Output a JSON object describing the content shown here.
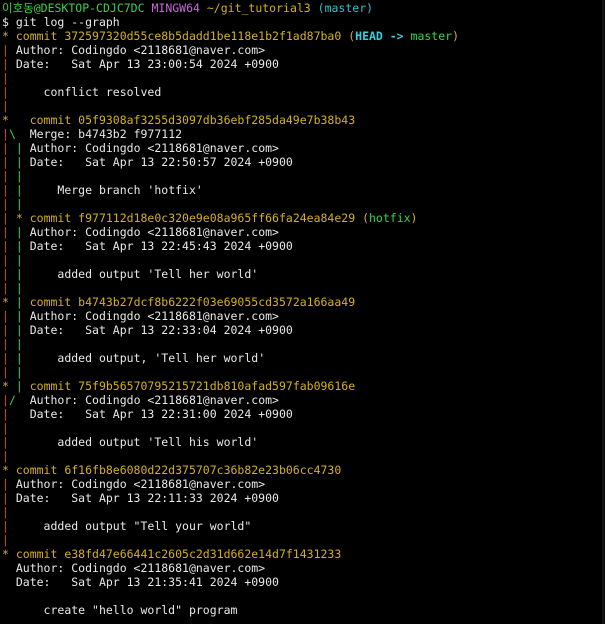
{
  "prompt": {
    "user_host": "이호동@DESKTOP-CDJC7DC",
    "shell": "MINGW64",
    "path": "~/git_tutorial3",
    "branch": "(master)",
    "symbol": "$",
    "command": "git log --graph"
  },
  "colors": {
    "graph_red": "#e03a3a",
    "graph_green": "#3bd14b",
    "commit_yellow": "#d5b01e",
    "prompt_magenta": "#c86ad6",
    "branch_cyan": "#2fbfcf",
    "text": "#e8e8e8",
    "background": "#000000"
  },
  "lines": [
    {
      "graph": "",
      "parts": [
        {
          "t": "prompt.user_host",
          "c": "c-green"
        },
        {
          "s": " "
        },
        {
          "t": "prompt.shell",
          "c": "c-magenta"
        },
        {
          "s": " "
        },
        {
          "t": "prompt.path",
          "c": "c-yellow"
        },
        {
          "s": " "
        },
        {
          "t": "prompt.branch",
          "c": "c-cyan"
        }
      ]
    },
    {
      "graph": "",
      "parts": [
        {
          "t": "prompt.symbol",
          "c": "c-white"
        },
        {
          "s": " "
        },
        {
          "t": "prompt.command",
          "c": "c-white"
        }
      ]
    },
    {
      "g": [
        {
          "s": "* ",
          "c": "c-yellow"
        }
      ],
      "parts": [
        {
          "text": "commit 372597320d55ce8b5dadd1be118e1b2f1ad87ba0",
          "c": "c-yellow"
        },
        {
          "text": " (",
          "c": "c-yellow"
        },
        {
          "text": "HEAD -> ",
          "c": "c-head"
        },
        {
          "text": "master",
          "c": "c-green"
        },
        {
          "text": ")",
          "c": "c-yellow"
        }
      ]
    },
    {
      "g": [
        {
          "s": "| ",
          "c": "c-red"
        }
      ],
      "parts": [
        {
          "text": "Author: Codingdo <2118681@naver.com>"
        }
      ]
    },
    {
      "g": [
        {
          "s": "| ",
          "c": "c-red"
        }
      ],
      "parts": [
        {
          "text": "Date:   Sat Apr 13 23:00:54 2024 +0900"
        }
      ]
    },
    {
      "g": [
        {
          "s": "| ",
          "c": "c-red"
        }
      ],
      "parts": []
    },
    {
      "g": [
        {
          "s": "| ",
          "c": "c-red"
        }
      ],
      "parts": [
        {
          "text": "    conflict resolved"
        }
      ]
    },
    {
      "g": [
        {
          "s": "| ",
          "c": "c-red"
        }
      ],
      "parts": []
    },
    {
      "g": [
        {
          "s": "*   ",
          "c": "c-yellow"
        }
      ],
      "parts": [
        {
          "text": "commit 05f9308af3255d3097db36ebf285da49e7b38b43",
          "c": "c-yellow"
        }
      ]
    },
    {
      "g": [
        {
          "s": "|",
          "c": "c-red"
        },
        {
          "s": "\\  ",
          "c": "c-green"
        }
      ],
      "parts": [
        {
          "text": "Merge: b4743b2 f977112"
        }
      ]
    },
    {
      "g": [
        {
          "s": "| ",
          "c": "c-red"
        },
        {
          "s": "| ",
          "c": "c-green"
        }
      ],
      "parts": [
        {
          "text": "Author: Codingdo <2118681@naver.com>"
        }
      ]
    },
    {
      "g": [
        {
          "s": "| ",
          "c": "c-red"
        },
        {
          "s": "| ",
          "c": "c-green"
        }
      ],
      "parts": [
        {
          "text": "Date:   Sat Apr 13 22:50:57 2024 +0900"
        }
      ]
    },
    {
      "g": [
        {
          "s": "| ",
          "c": "c-red"
        },
        {
          "s": "| ",
          "c": "c-green"
        }
      ],
      "parts": []
    },
    {
      "g": [
        {
          "s": "| ",
          "c": "c-red"
        },
        {
          "s": "| ",
          "c": "c-green"
        }
      ],
      "parts": [
        {
          "text": "    Merge branch 'hotfix'"
        }
      ]
    },
    {
      "g": [
        {
          "s": "| ",
          "c": "c-red"
        },
        {
          "s": "| ",
          "c": "c-green"
        }
      ],
      "parts": []
    },
    {
      "g": [
        {
          "s": "| ",
          "c": "c-red"
        },
        {
          "s": "* ",
          "c": "c-yellow"
        }
      ],
      "parts": [
        {
          "text": "commit f977112d18e0c320e9e08a965ff66fa24ea84e29",
          "c": "c-yellow"
        },
        {
          "text": " (",
          "c": "c-yellow"
        },
        {
          "text": "hotfix",
          "c": "c-green"
        },
        {
          "text": ")",
          "c": "c-yellow"
        }
      ]
    },
    {
      "g": [
        {
          "s": "| ",
          "c": "c-red"
        },
        {
          "s": "| ",
          "c": "c-green"
        }
      ],
      "parts": [
        {
          "text": "Author: Codingdo <2118681@naver.com>"
        }
      ]
    },
    {
      "g": [
        {
          "s": "| ",
          "c": "c-red"
        },
        {
          "s": "| ",
          "c": "c-green"
        }
      ],
      "parts": [
        {
          "text": "Date:   Sat Apr 13 22:45:43 2024 +0900"
        }
      ]
    },
    {
      "g": [
        {
          "s": "| ",
          "c": "c-red"
        },
        {
          "s": "| ",
          "c": "c-green"
        }
      ],
      "parts": []
    },
    {
      "g": [
        {
          "s": "| ",
          "c": "c-red"
        },
        {
          "s": "| ",
          "c": "c-green"
        }
      ],
      "parts": [
        {
          "text": "    added output 'Tell her world'"
        }
      ]
    },
    {
      "g": [
        {
          "s": "| ",
          "c": "c-red"
        },
        {
          "s": "| ",
          "c": "c-green"
        }
      ],
      "parts": []
    },
    {
      "g": [
        {
          "s": "* ",
          "c": "c-yellow"
        },
        {
          "s": "| ",
          "c": "c-green"
        }
      ],
      "parts": [
        {
          "text": "commit b4743b27dcf8b6222f03e69055cd3572a166aa49",
          "c": "c-yellow"
        }
      ]
    },
    {
      "g": [
        {
          "s": "| ",
          "c": "c-red"
        },
        {
          "s": "| ",
          "c": "c-green"
        }
      ],
      "parts": [
        {
          "text": "Author: Codingdo <2118681@naver.com>"
        }
      ]
    },
    {
      "g": [
        {
          "s": "| ",
          "c": "c-red"
        },
        {
          "s": "| ",
          "c": "c-green"
        }
      ],
      "parts": [
        {
          "text": "Date:   Sat Apr 13 22:33:04 2024 +0900"
        }
      ]
    },
    {
      "g": [
        {
          "s": "| ",
          "c": "c-red"
        },
        {
          "s": "| ",
          "c": "c-green"
        }
      ],
      "parts": []
    },
    {
      "g": [
        {
          "s": "| ",
          "c": "c-red"
        },
        {
          "s": "| ",
          "c": "c-green"
        }
      ],
      "parts": [
        {
          "text": "    added output, 'Tell her world'"
        }
      ]
    },
    {
      "g": [
        {
          "s": "| ",
          "c": "c-red"
        },
        {
          "s": "| ",
          "c": "c-green"
        }
      ],
      "parts": []
    },
    {
      "g": [
        {
          "s": "* ",
          "c": "c-yellow"
        },
        {
          "s": "| ",
          "c": "c-green"
        }
      ],
      "parts": [
        {
          "text": "commit 75f9b56570795215721db810afad597fab09616e",
          "c": "c-yellow"
        }
      ]
    },
    {
      "g": [
        {
          "s": "|",
          "c": "c-red"
        },
        {
          "s": "/  ",
          "c": "c-green"
        }
      ],
      "parts": [
        {
          "text": "Author: Codingdo <2118681@naver.com>"
        }
      ]
    },
    {
      "g": [
        {
          "s": "|   ",
          "c": "c-red"
        }
      ],
      "parts": [
        {
          "text": "Date:   Sat Apr 13 22:31:00 2024 +0900"
        }
      ]
    },
    {
      "g": [
        {
          "s": "|   ",
          "c": "c-red"
        }
      ],
      "parts": []
    },
    {
      "g": [
        {
          "s": "|   ",
          "c": "c-red"
        }
      ],
      "parts": [
        {
          "text": "    added output 'Tell his world'"
        }
      ]
    },
    {
      "g": [
        {
          "s": "|   ",
          "c": "c-red"
        }
      ],
      "parts": []
    },
    {
      "g": [
        {
          "s": "* ",
          "c": "c-yellow"
        }
      ],
      "parts": [
        {
          "text": "commit 6f16fb8e6080d22d375707c36b82e23b06cc4730",
          "c": "c-yellow"
        }
      ]
    },
    {
      "g": [
        {
          "s": "| ",
          "c": "c-red"
        }
      ],
      "parts": [
        {
          "text": "Author: Codingdo <2118681@naver.com>"
        }
      ]
    },
    {
      "g": [
        {
          "s": "| ",
          "c": "c-red"
        }
      ],
      "parts": [
        {
          "text": "Date:   Sat Apr 13 22:11:33 2024 +0900"
        }
      ]
    },
    {
      "g": [
        {
          "s": "| ",
          "c": "c-red"
        }
      ],
      "parts": []
    },
    {
      "g": [
        {
          "s": "| ",
          "c": "c-red"
        }
      ],
      "parts": [
        {
          "text": "    added output \"Tell your world\""
        }
      ]
    },
    {
      "g": [
        {
          "s": "| ",
          "c": "c-red"
        }
      ],
      "parts": []
    },
    {
      "g": [
        {
          "s": "* ",
          "c": "c-yellow"
        }
      ],
      "parts": [
        {
          "text": "commit e38fd47e66441c2605c2d31d662e14d7f1431233",
          "c": "c-yellow"
        }
      ]
    },
    {
      "g": [
        {
          "s": "  "
        }
      ],
      "parts": [
        {
          "text": "Author: Codingdo <2118681@naver.com>"
        }
      ]
    },
    {
      "g": [
        {
          "s": "  "
        }
      ],
      "parts": [
        {
          "text": "Date:   Sat Apr 13 21:35:41 2024 +0900"
        }
      ]
    },
    {
      "g": [
        {
          "s": "  "
        }
      ],
      "parts": []
    },
    {
      "g": [
        {
          "s": "  "
        }
      ],
      "parts": [
        {
          "text": "    create \"hello world\" program"
        }
      ]
    }
  ]
}
